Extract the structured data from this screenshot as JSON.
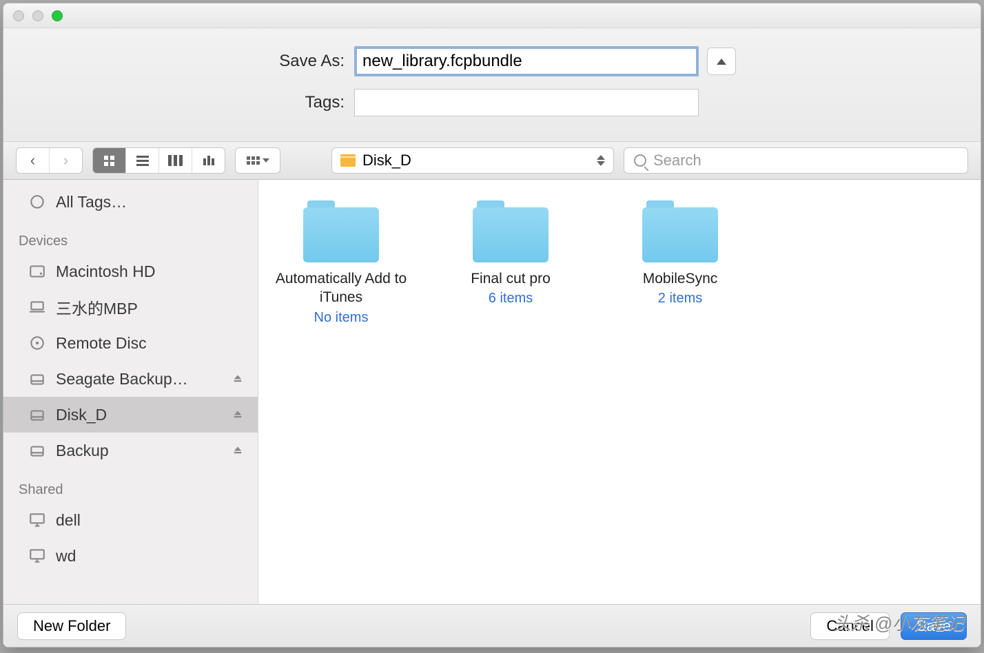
{
  "form": {
    "saveas_label": "Save As:",
    "saveas_value": "new_library.fcpbundle",
    "tags_label": "Tags:",
    "tags_value": ""
  },
  "toolbar": {
    "location": "Disk_D",
    "search_placeholder": "Search"
  },
  "sidebar": {
    "all_tags": "All Tags…",
    "devices_header": "Devices",
    "devices": [
      {
        "label": "Macintosh HD",
        "icon": "hdd",
        "eject": false
      },
      {
        "label": "三水的MBP",
        "icon": "laptop",
        "eject": false
      },
      {
        "label": "Remote Disc",
        "icon": "disc",
        "eject": false
      },
      {
        "label": "Seagate Backup…",
        "icon": "ext",
        "eject": true
      },
      {
        "label": "Disk_D",
        "icon": "ext",
        "eject": true,
        "selected": true
      },
      {
        "label": "Backup",
        "icon": "ext",
        "eject": true
      }
    ],
    "shared_header": "Shared",
    "shared": [
      {
        "label": "dell",
        "icon": "monitor"
      },
      {
        "label": "wd",
        "icon": "monitor"
      }
    ]
  },
  "folders": [
    {
      "name": "Automatically Add to iTunes",
      "sub": "No items"
    },
    {
      "name": "Final cut pro",
      "sub": "6 items"
    },
    {
      "name": "MobileSync",
      "sub": "2 items"
    }
  ],
  "footer": {
    "new_folder": "New Folder",
    "cancel": "Cancel",
    "save": "Save"
  },
  "watermark": "头杀 @小灰笔记"
}
